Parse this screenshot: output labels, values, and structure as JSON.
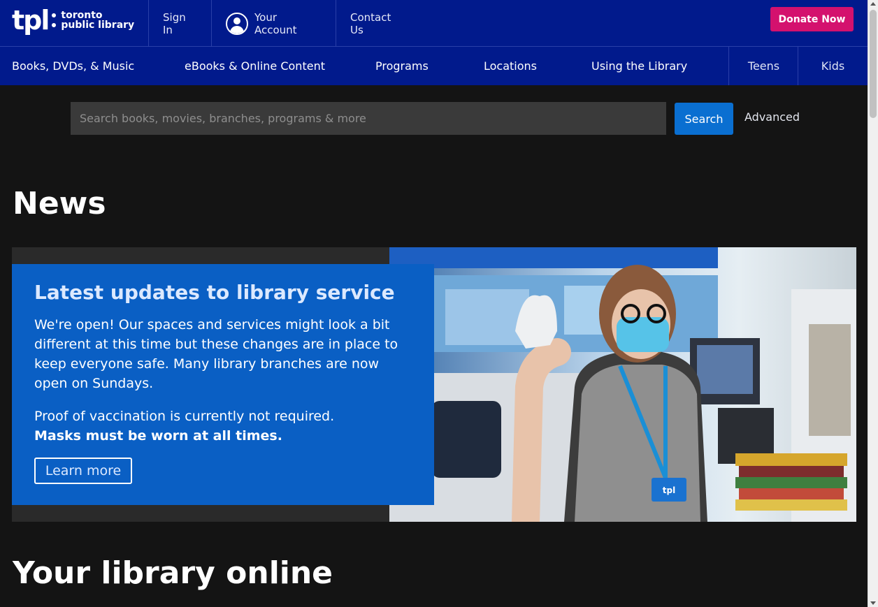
{
  "logo": {
    "mark": "tpl",
    "line1": "toronto",
    "line2": "public library"
  },
  "utility_nav": {
    "sign_in": "Sign In",
    "your_account": "Your Account",
    "contact_us": "Contact Us",
    "donate": "Donate Now"
  },
  "main_nav": {
    "items": [
      {
        "label": "Books, DVDs, & Music"
      },
      {
        "label": "eBooks & Online Content"
      },
      {
        "label": "Programs"
      },
      {
        "label": "Locations"
      },
      {
        "label": "Using the Library"
      },
      {
        "label": "Teens"
      },
      {
        "label": "Kids"
      }
    ]
  },
  "search": {
    "placeholder": "Search books, movies, branches, programs & more",
    "value": "",
    "button": "Search",
    "advanced": "Advanced"
  },
  "news": {
    "heading": "News",
    "hero": {
      "title": "Latest updates to library service",
      "paragraph1": "We're open! Our spaces and services might look a bit different at this time but these changes are in place to keep everyone safe. Many library branches are now open on Sundays.",
      "paragraph2": "Proof of vaccination is currently not required.",
      "paragraph2_strong": "Masks must be worn at all times.",
      "button": "Learn more",
      "badge_text": "tpl"
    }
  },
  "online": {
    "heading": "Your library online"
  },
  "colors": {
    "nav_bg": "#011a8c",
    "donate_bg": "#d4116e",
    "search_button": "#0a6fd1",
    "hero_card": "#0a5fc4",
    "page_bg": "#141414"
  },
  "icons": {
    "account": "user-circle-icon"
  }
}
